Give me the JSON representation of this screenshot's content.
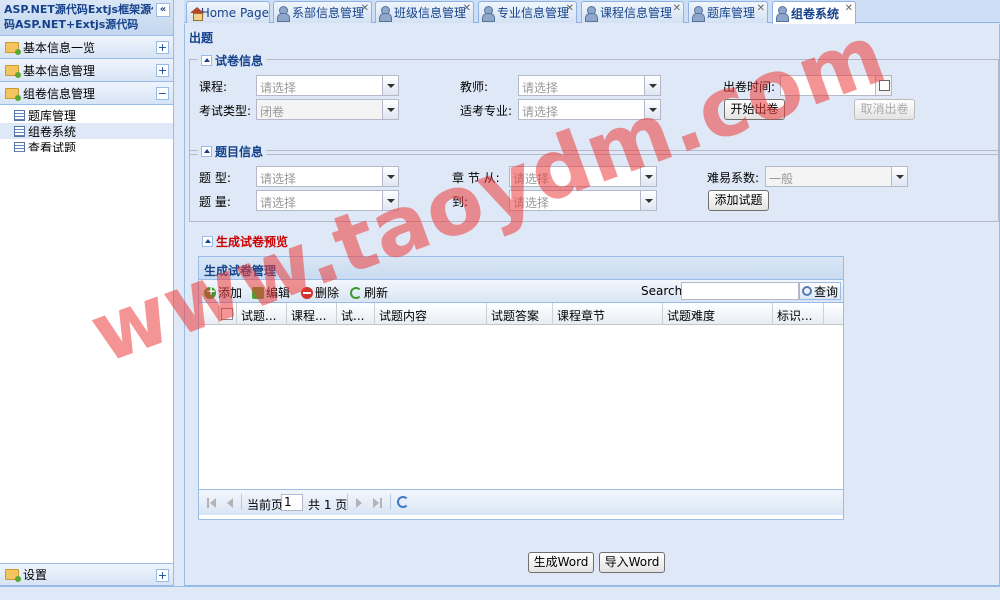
{
  "sidebar": {
    "title_line1": "ASP.NET源代码Extjs框架源代",
    "title_line2": "码ASP.NET+Extjs源代码",
    "collapse": "«",
    "groups": [
      {
        "label": "基本信息一览",
        "toggle": "+"
      },
      {
        "label": "基本信息管理",
        "toggle": "+"
      },
      {
        "label": "组卷信息管理",
        "toggle": "−"
      }
    ],
    "tree_items": [
      {
        "label": "题库管理"
      },
      {
        "label": "组卷系统"
      },
      {
        "label": "查看试题"
      }
    ],
    "settings": {
      "label": "设置",
      "toggle": "+"
    }
  },
  "tabs": [
    {
      "label": "Home Page"
    },
    {
      "label": "系部信息管理"
    },
    {
      "label": "班级信息管理"
    },
    {
      "label": "专业信息管理"
    },
    {
      "label": "课程信息管理"
    },
    {
      "label": "题库管理"
    },
    {
      "label": "组卷系统"
    }
  ],
  "tab_close": "✕",
  "main": {
    "title": "出题",
    "paper_info": {
      "legend": "试卷信息",
      "course_label": "课程:",
      "course_value": "请选择",
      "teacher_label": "教师:",
      "teacher_value": "请选择",
      "date_label": "出卷时间:",
      "exam_type_label": "考试类型:",
      "exam_type_value": "闭卷",
      "major_label": "适考专业:",
      "major_value": "请选择",
      "start_button": "开始出卷",
      "cancel_button": "取消出卷"
    },
    "question_info": {
      "legend": "题目信息",
      "type_label": "题 型:",
      "type_value": "请选择",
      "chapter_from_label": "章 节 从:",
      "chapter_from_value": "请选择",
      "difficulty_label": "难易系数:",
      "difficulty_value": "一般",
      "count_label": "题 量:",
      "count_value": "请选择",
      "to_label": "到:",
      "to_value": "请选择",
      "add_button": "添加试题"
    },
    "preview": {
      "legend": "生成试卷预览",
      "grid_title": "生成试卷管理",
      "toolbar": {
        "add": "添加",
        "edit": "编辑",
        "delete": "删除",
        "refresh": "刷新",
        "search_label": "Search:",
        "search_value": "",
        "search_button": "查询"
      },
      "columns": [
        "试题...",
        "课程...",
        "试...",
        "试题内容",
        "试题答案",
        "课程章节",
        "试题难度",
        "标识..."
      ],
      "paging": {
        "current_page_label": "当前页",
        "current_page": "1",
        "total_label": "共 1 页"
      }
    },
    "generate_word": "生成Word",
    "import_word": "导入Word"
  },
  "watermark": "www.taoydm.com"
}
